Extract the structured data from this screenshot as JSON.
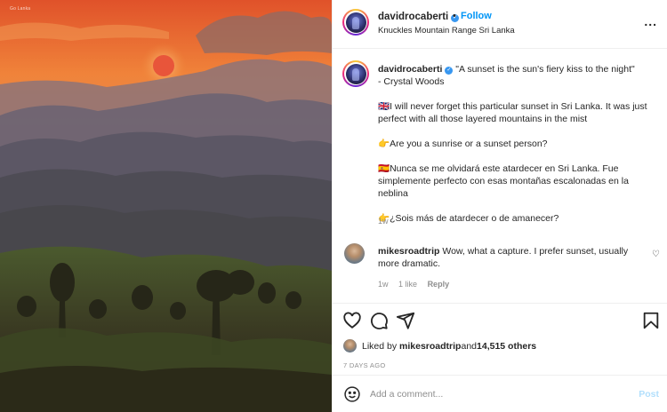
{
  "photo": {
    "watermark": "Go Lanka"
  },
  "header": {
    "username": "davidrocaberti",
    "verified_mark": "✓",
    "separator": "•",
    "follow_label": "Follow",
    "location": "Knuckles Mountain Range Sri Lanka",
    "more_label": "..."
  },
  "caption": {
    "username": "davidrocaberti",
    "verified_mark": "✓",
    "quote_line": " \"A sunset is the sun's fiery kiss to the night\"",
    "quote_author": "- Crystal Woods",
    "paragraphs": [
      "🇬🇧I will never forget this particular sunset in Sri Lanka. It was just perfect with all those layered mountains in the mist",
      "👉Are you a sunrise or a sunset person?",
      "🇪🇸Nunca se me olvidará este atardecer en Sri Lanka. Fue simplemente perfecto con esas montañas escalonadas en la neblina",
      "👉¿Sois más de atardecer o de amanecer?"
    ],
    "time": "1w"
  },
  "comment": {
    "username": "mikesroadtrip",
    "text": " Wow, what a capture. I prefer sunset, usually more dramatic.",
    "time": "1w",
    "likes": "1 like",
    "reply_label": "Reply",
    "heart_glyph": "♡"
  },
  "likes": {
    "prefix": "Liked by ",
    "user": "mikesroadtrip",
    "middle": " and ",
    "others": "14,515 others"
  },
  "post_date": "7 DAYS AGO",
  "add_comment": {
    "placeholder": "Add a comment...",
    "post_label": "Post"
  },
  "icons": {
    "like": "heart-icon",
    "comment": "comment-bubble-icon",
    "share": "paper-plane-icon",
    "save": "bookmark-icon",
    "emoji": "smiley-icon",
    "more": "more-horizontal-icon"
  },
  "colors": {
    "accent": "#0095f6",
    "verified": "#3897f0",
    "muted": "#8e8e8e",
    "post_disabled": "#b2dffc"
  }
}
